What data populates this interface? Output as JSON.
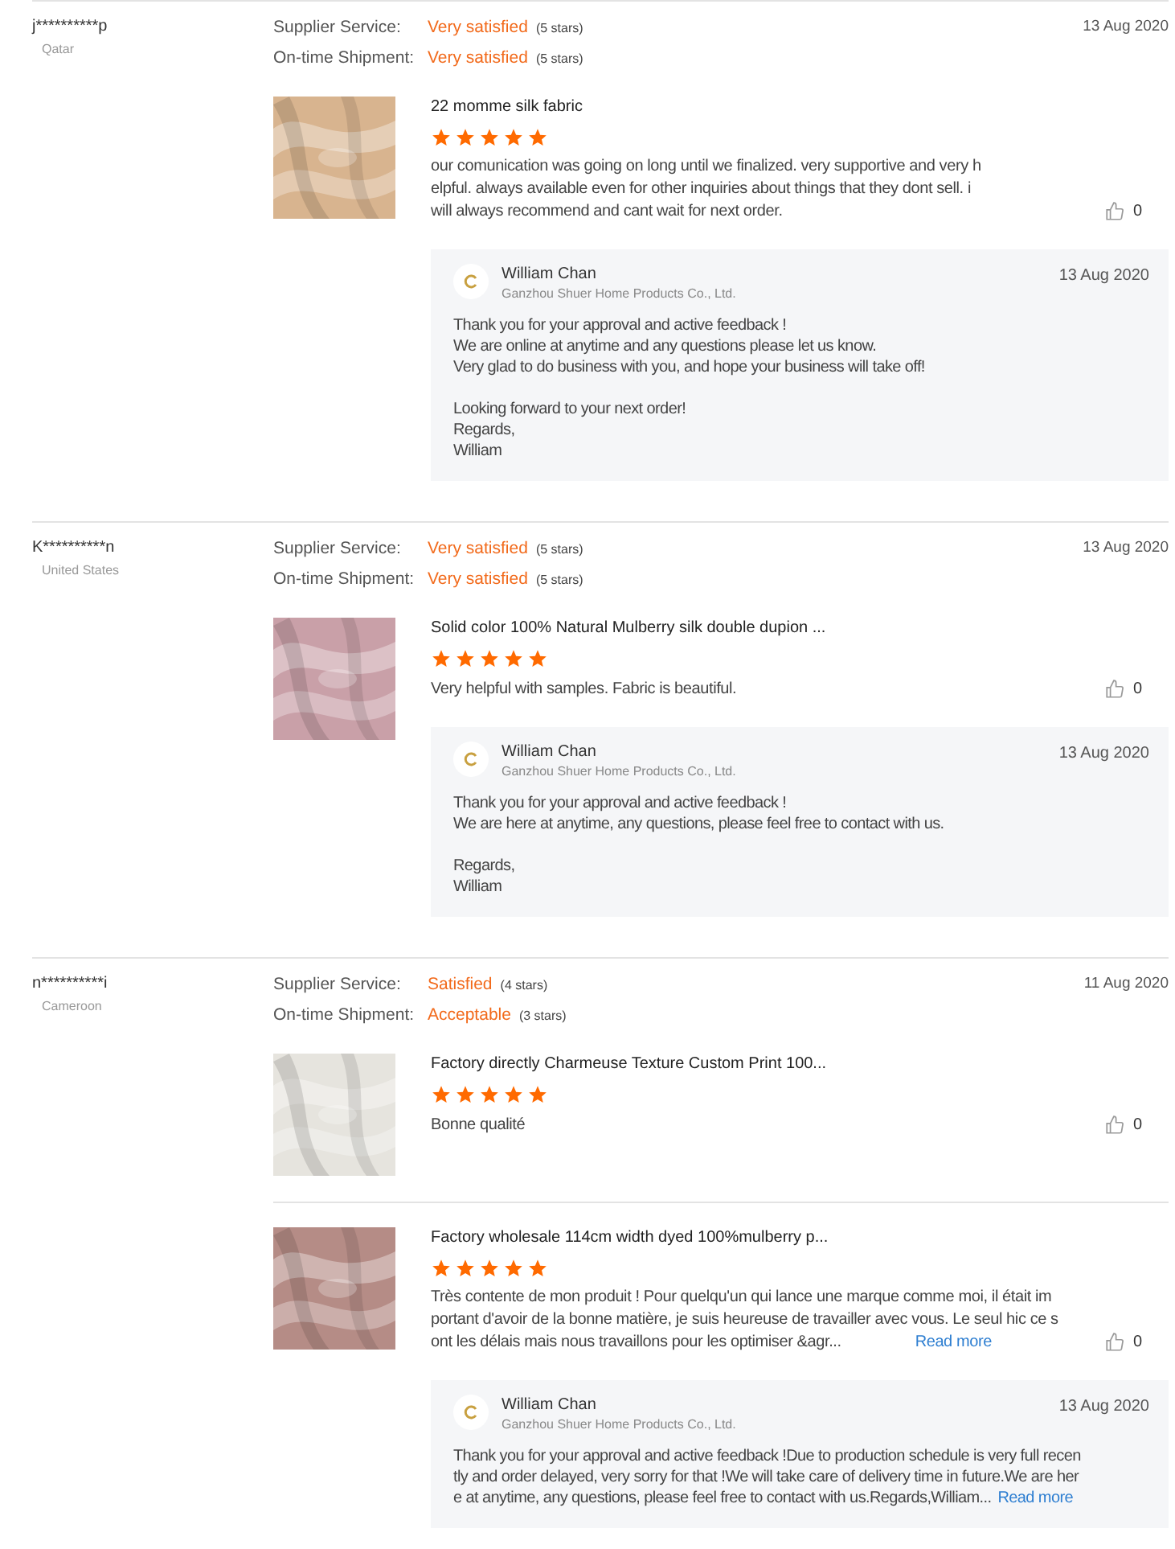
{
  "reviews": [
    {
      "buyer": "j**********p",
      "country": "Qatar",
      "date": "13 Aug 2020",
      "ratings": [
        {
          "label": "Supplier Service:",
          "value": "Very satisfied",
          "stars_text": "(5 stars)"
        },
        {
          "label": "On-time Shipment:",
          "value": "Very satisfied",
          "stars_text": "(5 stars)"
        }
      ],
      "products": [
        {
          "title": "22 momme silk fabric",
          "stars": 5,
          "text_lines": [
            "our comunication was going on long until we finalized. very supportive and very h",
            "elpful.  always available even for other inquiries about things that they dont sell. i",
            "will always recommend and cant wait for next order."
          ],
          "likes": "0",
          "image": {
            "kind": "picture",
            "color": "#d8b48f"
          },
          "reply": {
            "name": "William Chan",
            "company": "Ganzhou Shuer Home Products Co., Ltd.",
            "date": "13 Aug 2020",
            "paragraphs": [
              [
                "Thank you for your approval and active feedback !",
                "We are online at anytime and any questions please let us know.",
                "Very glad to do business with you, and hope your business will take off!"
              ],
              [
                "Looking forward to your next order!",
                "Regards,",
                "William"
              ]
            ]
          }
        }
      ]
    },
    {
      "buyer": "K**********n",
      "country": "United States",
      "date": "13 Aug 2020",
      "ratings": [
        {
          "label": "Supplier Service:",
          "value": "Very satisfied",
          "stars_text": "(5 stars)"
        },
        {
          "label": "On-time Shipment:",
          "value": "Very satisfied",
          "stars_text": "(5 stars)"
        }
      ],
      "products": [
        {
          "title": "Solid color 100% Natural Mulberry silk double dupion ...",
          "stars": 5,
          "text_lines": [
            "Very helpful with samples.  Fabric is beautiful."
          ],
          "likes": "0",
          "image": {
            "kind": "picture",
            "color": "#c9a0a8"
          },
          "reply": {
            "name": "William Chan",
            "company": "Ganzhou Shuer Home Products Co., Ltd.",
            "date": "13 Aug 2020",
            "paragraphs": [
              [
                "Thank you for your approval and active feedback !",
                "We are here at anytime, any questions, please feel free to contact with us."
              ],
              [
                "Regards,",
                "William"
              ]
            ]
          }
        }
      ]
    },
    {
      "buyer": "n**********i",
      "country": "Cameroon",
      "date": "11 Aug 2020",
      "ratings": [
        {
          "label": "Supplier Service:",
          "value": "Satisfied",
          "stars_text": "(4 stars)"
        },
        {
          "label": "On-time Shipment:",
          "value": "Acceptable",
          "stars_text": "(3 stars)"
        }
      ],
      "products": [
        {
          "title": "Factory directly Charmeuse Texture Custom Print 100...",
          "stars": 5,
          "text_lines": [
            "Bonne qualité"
          ],
          "likes": "0",
          "image": {
            "kind": "picture",
            "color": "#e6e4de"
          }
        },
        {
          "title": "Factory wholesale 114cm width dyed 100%mulberry p...",
          "stars": 5,
          "text_lines": [
            "Très contente de mon produit ! Pour quelqu'un qui lance une marque comme moi, il était im",
            "portant d'avoir de la bonne matière, je suis heureuse de travailler avec vous. Le seul hic ce s",
            "ont les délais mais nous travaillons pour les optimiser &agr..."
          ],
          "read_more": "Read more",
          "likes": "0",
          "image": {
            "kind": "picture",
            "color": "#b58c86"
          },
          "reply": {
            "name": "William Chan",
            "company": "Ganzhou Shuer Home Products Co., Ltd.",
            "date": "13 Aug 2020",
            "paragraphs": [
              [
                "Thank you for your approval and active feedback !Due to production schedule is very full recen",
                "tly and order delayed, very sorry for that !We will take care of delivery time in future.We are her",
                "e at anytime, any questions, please feel free to contact with us.Regards,William..."
              ]
            ],
            "read_more": "Read more"
          }
        }
      ]
    }
  ]
}
